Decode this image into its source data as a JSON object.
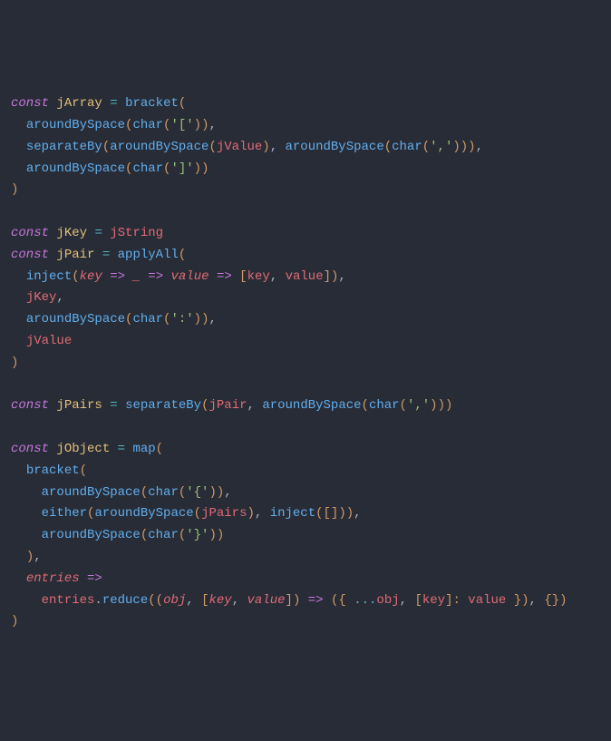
{
  "lines": [
    [
      {
        "t": "const ",
        "c": "kw"
      },
      {
        "t": "jArray",
        "c": "const-name"
      },
      {
        "t": " ",
        "c": "punct"
      },
      {
        "t": "=",
        "c": "op"
      },
      {
        "t": " ",
        "c": "punct"
      },
      {
        "t": "bracket",
        "c": "fn"
      },
      {
        "t": "(",
        "c": "deco"
      }
    ],
    [
      {
        "t": "  ",
        "c": "punct"
      },
      {
        "t": "aroundBySpace",
        "c": "fn"
      },
      {
        "t": "(",
        "c": "deco"
      },
      {
        "t": "char",
        "c": "fn"
      },
      {
        "t": "(",
        "c": "deco"
      },
      {
        "t": "'['",
        "c": "str"
      },
      {
        "t": "))",
        "c": "deco"
      },
      {
        "t": ",",
        "c": "punct"
      }
    ],
    [
      {
        "t": "  ",
        "c": "punct"
      },
      {
        "t": "separateBy",
        "c": "fn"
      },
      {
        "t": "(",
        "c": "deco"
      },
      {
        "t": "aroundBySpace",
        "c": "fn"
      },
      {
        "t": "(",
        "c": "deco"
      },
      {
        "t": "jValue",
        "c": "ident"
      },
      {
        "t": ")",
        "c": "deco"
      },
      {
        "t": ", ",
        "c": "punct"
      },
      {
        "t": "aroundBySpace",
        "c": "fn"
      },
      {
        "t": "(",
        "c": "deco"
      },
      {
        "t": "char",
        "c": "fn"
      },
      {
        "t": "(",
        "c": "deco"
      },
      {
        "t": "','",
        "c": "str"
      },
      {
        "t": ")))",
        "c": "deco"
      },
      {
        "t": ",",
        "c": "punct"
      }
    ],
    [
      {
        "t": "  ",
        "c": "punct"
      },
      {
        "t": "aroundBySpace",
        "c": "fn"
      },
      {
        "t": "(",
        "c": "deco"
      },
      {
        "t": "char",
        "c": "fn"
      },
      {
        "t": "(",
        "c": "deco"
      },
      {
        "t": "']'",
        "c": "str"
      },
      {
        "t": "))",
        "c": "deco"
      }
    ],
    [
      {
        "t": ")",
        "c": "deco"
      }
    ],
    [],
    [
      {
        "t": "const ",
        "c": "kw"
      },
      {
        "t": "jKey",
        "c": "const-name"
      },
      {
        "t": " ",
        "c": "punct"
      },
      {
        "t": "=",
        "c": "op"
      },
      {
        "t": " ",
        "c": "punct"
      },
      {
        "t": "jString",
        "c": "ident"
      }
    ],
    [
      {
        "t": "const ",
        "c": "kw"
      },
      {
        "t": "jPair",
        "c": "const-name"
      },
      {
        "t": " ",
        "c": "punct"
      },
      {
        "t": "=",
        "c": "op"
      },
      {
        "t": " ",
        "c": "punct"
      },
      {
        "t": "applyAll",
        "c": "fn"
      },
      {
        "t": "(",
        "c": "deco"
      }
    ],
    [
      {
        "t": "  ",
        "c": "punct"
      },
      {
        "t": "inject",
        "c": "fn"
      },
      {
        "t": "(",
        "c": "deco"
      },
      {
        "t": "key",
        "c": "param"
      },
      {
        "t": " ",
        "c": "punct"
      },
      {
        "t": "=>",
        "c": "arrow"
      },
      {
        "t": " ",
        "c": "punct"
      },
      {
        "t": "_",
        "c": "param"
      },
      {
        "t": " ",
        "c": "punct"
      },
      {
        "t": "=>",
        "c": "arrow"
      },
      {
        "t": " ",
        "c": "punct"
      },
      {
        "t": "value",
        "c": "param"
      },
      {
        "t": " ",
        "c": "punct"
      },
      {
        "t": "=>",
        "c": "arrow"
      },
      {
        "t": " ",
        "c": "punct"
      },
      {
        "t": "[",
        "c": "deco"
      },
      {
        "t": "key",
        "c": "ident"
      },
      {
        "t": ", ",
        "c": "punct"
      },
      {
        "t": "value",
        "c": "ident"
      },
      {
        "t": "])",
        "c": "deco"
      },
      {
        "t": ",",
        "c": "punct"
      }
    ],
    [
      {
        "t": "  ",
        "c": "punct"
      },
      {
        "t": "jKey",
        "c": "ident"
      },
      {
        "t": ",",
        "c": "punct"
      }
    ],
    [
      {
        "t": "  ",
        "c": "punct"
      },
      {
        "t": "aroundBySpace",
        "c": "fn"
      },
      {
        "t": "(",
        "c": "deco"
      },
      {
        "t": "char",
        "c": "fn"
      },
      {
        "t": "(",
        "c": "deco"
      },
      {
        "t": "':'",
        "c": "str"
      },
      {
        "t": "))",
        "c": "deco"
      },
      {
        "t": ",",
        "c": "punct"
      }
    ],
    [
      {
        "t": "  ",
        "c": "punct"
      },
      {
        "t": "jValue",
        "c": "ident"
      }
    ],
    [
      {
        "t": ")",
        "c": "deco"
      }
    ],
    [],
    [
      {
        "t": "const ",
        "c": "kw"
      },
      {
        "t": "jPairs",
        "c": "const-name"
      },
      {
        "t": " ",
        "c": "punct"
      },
      {
        "t": "=",
        "c": "op"
      },
      {
        "t": " ",
        "c": "punct"
      },
      {
        "t": "separateBy",
        "c": "fn"
      },
      {
        "t": "(",
        "c": "deco"
      },
      {
        "t": "jPair",
        "c": "ident"
      },
      {
        "t": ", ",
        "c": "punct"
      },
      {
        "t": "aroundBySpace",
        "c": "fn"
      },
      {
        "t": "(",
        "c": "deco"
      },
      {
        "t": "char",
        "c": "fn"
      },
      {
        "t": "(",
        "c": "deco"
      },
      {
        "t": "','",
        "c": "str"
      },
      {
        "t": ")))",
        "c": "deco"
      }
    ],
    [],
    [
      {
        "t": "const ",
        "c": "kw"
      },
      {
        "t": "jObject",
        "c": "const-name"
      },
      {
        "t": " ",
        "c": "punct"
      },
      {
        "t": "=",
        "c": "op"
      },
      {
        "t": " ",
        "c": "punct"
      },
      {
        "t": "map",
        "c": "fn"
      },
      {
        "t": "(",
        "c": "deco"
      }
    ],
    [
      {
        "t": "  ",
        "c": "punct"
      },
      {
        "t": "bracket",
        "c": "fn"
      },
      {
        "t": "(",
        "c": "deco"
      }
    ],
    [
      {
        "t": "    ",
        "c": "punct"
      },
      {
        "t": "aroundBySpace",
        "c": "fn"
      },
      {
        "t": "(",
        "c": "deco"
      },
      {
        "t": "char",
        "c": "fn"
      },
      {
        "t": "(",
        "c": "deco"
      },
      {
        "t": "'{'",
        "c": "str"
      },
      {
        "t": "))",
        "c": "deco"
      },
      {
        "t": ",",
        "c": "punct"
      }
    ],
    [
      {
        "t": "    ",
        "c": "punct"
      },
      {
        "t": "either",
        "c": "fn"
      },
      {
        "t": "(",
        "c": "deco"
      },
      {
        "t": "aroundBySpace",
        "c": "fn"
      },
      {
        "t": "(",
        "c": "deco"
      },
      {
        "t": "jPairs",
        "c": "ident"
      },
      {
        "t": ")",
        "c": "deco"
      },
      {
        "t": ", ",
        "c": "punct"
      },
      {
        "t": "inject",
        "c": "fn"
      },
      {
        "t": "(",
        "c": "deco"
      },
      {
        "t": "[]))",
        "c": "deco"
      },
      {
        "t": ",",
        "c": "punct"
      }
    ],
    [
      {
        "t": "    ",
        "c": "punct"
      },
      {
        "t": "aroundBySpace",
        "c": "fn"
      },
      {
        "t": "(",
        "c": "deco"
      },
      {
        "t": "char",
        "c": "fn"
      },
      {
        "t": "(",
        "c": "deco"
      },
      {
        "t": "'}'",
        "c": "str"
      },
      {
        "t": "))",
        "c": "deco"
      }
    ],
    [
      {
        "t": "  ",
        "c": "punct"
      },
      {
        "t": ")",
        "c": "deco"
      },
      {
        "t": ",",
        "c": "punct"
      }
    ],
    [
      {
        "t": "  ",
        "c": "punct"
      },
      {
        "t": "entries",
        "c": "param"
      },
      {
        "t": " ",
        "c": "punct"
      },
      {
        "t": "=>",
        "c": "arrow"
      }
    ],
    [
      {
        "t": "    ",
        "c": "punct"
      },
      {
        "t": "entries",
        "c": "ident"
      },
      {
        "t": ".",
        "c": "punct"
      },
      {
        "t": "reduce",
        "c": "fn"
      },
      {
        "t": "((",
        "c": "deco"
      },
      {
        "t": "obj",
        "c": "param"
      },
      {
        "t": ", ",
        "c": "punct"
      },
      {
        "t": "[",
        "c": "deco"
      },
      {
        "t": "key",
        "c": "param"
      },
      {
        "t": ", ",
        "c": "punct"
      },
      {
        "t": "value",
        "c": "param"
      },
      {
        "t": "])",
        "c": "deco"
      },
      {
        "t": " ",
        "c": "punct"
      },
      {
        "t": "=>",
        "c": "arrow"
      },
      {
        "t": " ",
        "c": "punct"
      },
      {
        "t": "({ ",
        "c": "deco"
      },
      {
        "t": "...",
        "c": "op"
      },
      {
        "t": "obj",
        "c": "ident"
      },
      {
        "t": ", ",
        "c": "punct"
      },
      {
        "t": "[",
        "c": "deco"
      },
      {
        "t": "key",
        "c": "ident"
      },
      {
        "t": "]:",
        "c": "deco"
      },
      {
        "t": " ",
        "c": "punct"
      },
      {
        "t": "value",
        "c": "ident"
      },
      {
        "t": " })",
        "c": "deco"
      },
      {
        "t": ", ",
        "c": "punct"
      },
      {
        "t": "{})",
        "c": "deco"
      }
    ],
    [
      {
        "t": ")",
        "c": "deco"
      }
    ]
  ]
}
